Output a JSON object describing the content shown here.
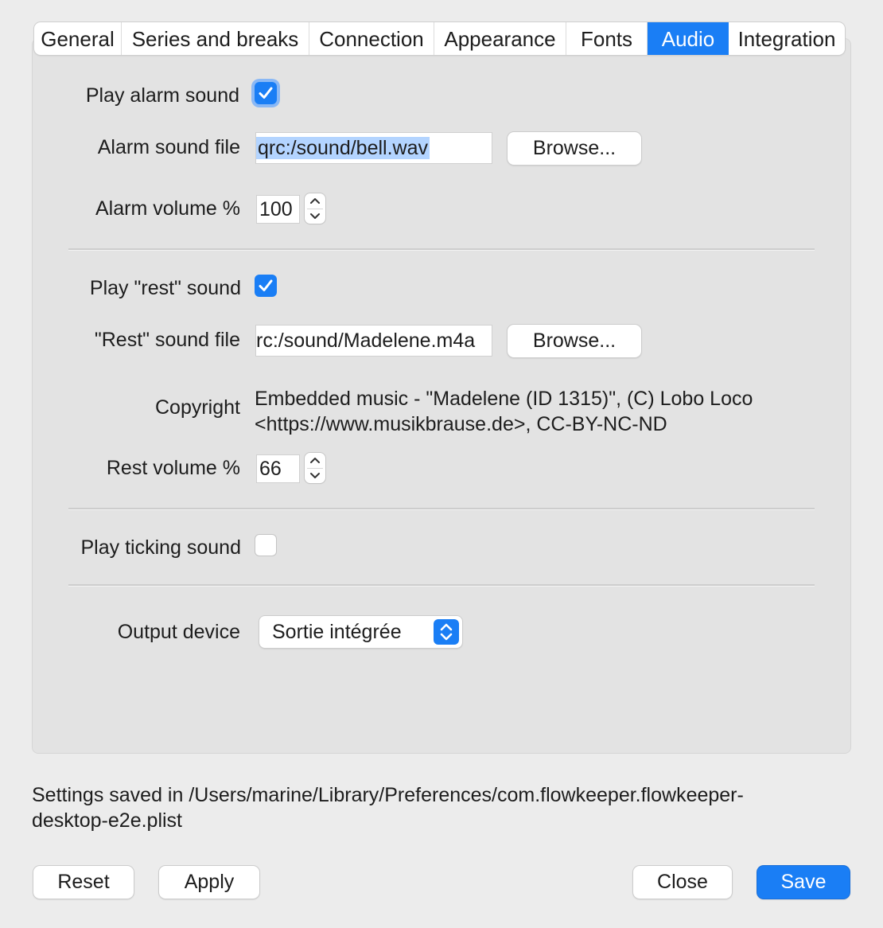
{
  "tabs": [
    "General",
    "Series and breaks",
    "Connection",
    "Appearance",
    "Fonts",
    "Audio",
    "Integration"
  ],
  "active_tab": "Audio",
  "alarm": {
    "play_label": "Play alarm sound",
    "play_checked": true,
    "file_label": "Alarm sound file",
    "file_value": "qrc:/sound/bell.wav",
    "browse_label": "Browse...",
    "volume_label": "Alarm volume %",
    "volume_value": "100"
  },
  "rest": {
    "play_label": "Play \"rest\" sound",
    "play_checked": true,
    "file_label": "\"Rest\" sound file",
    "file_value": "rc:/sound/Madelene.m4a",
    "browse_label": "Browse...",
    "copyright_label": "Copyright",
    "copyright_line1": "Embedded music - \"Madelene (ID 1315)\", (C) Lobo Loco",
    "copyright_line2": "<https://www.musikbrause.de>, CC-BY-NC-ND",
    "volume_label": "Rest volume %",
    "volume_value": "66"
  },
  "ticking": {
    "play_label": "Play ticking sound",
    "play_checked": false
  },
  "output": {
    "label": "Output device",
    "value": "Sortie intégrée"
  },
  "footer": {
    "settings_line1": "Settings saved in /Users/marine/Library/Preferences/com.flowkeeper.flowkeeper-",
    "settings_line2": "desktop-e2e.plist"
  },
  "buttons": {
    "reset": "Reset",
    "apply": "Apply",
    "close": "Close",
    "save": "Save"
  },
  "colors": {
    "accent": "#1a7ef5",
    "selection": "#b3d4ff",
    "background": "#ececec",
    "panel": "#e3e3e3"
  }
}
